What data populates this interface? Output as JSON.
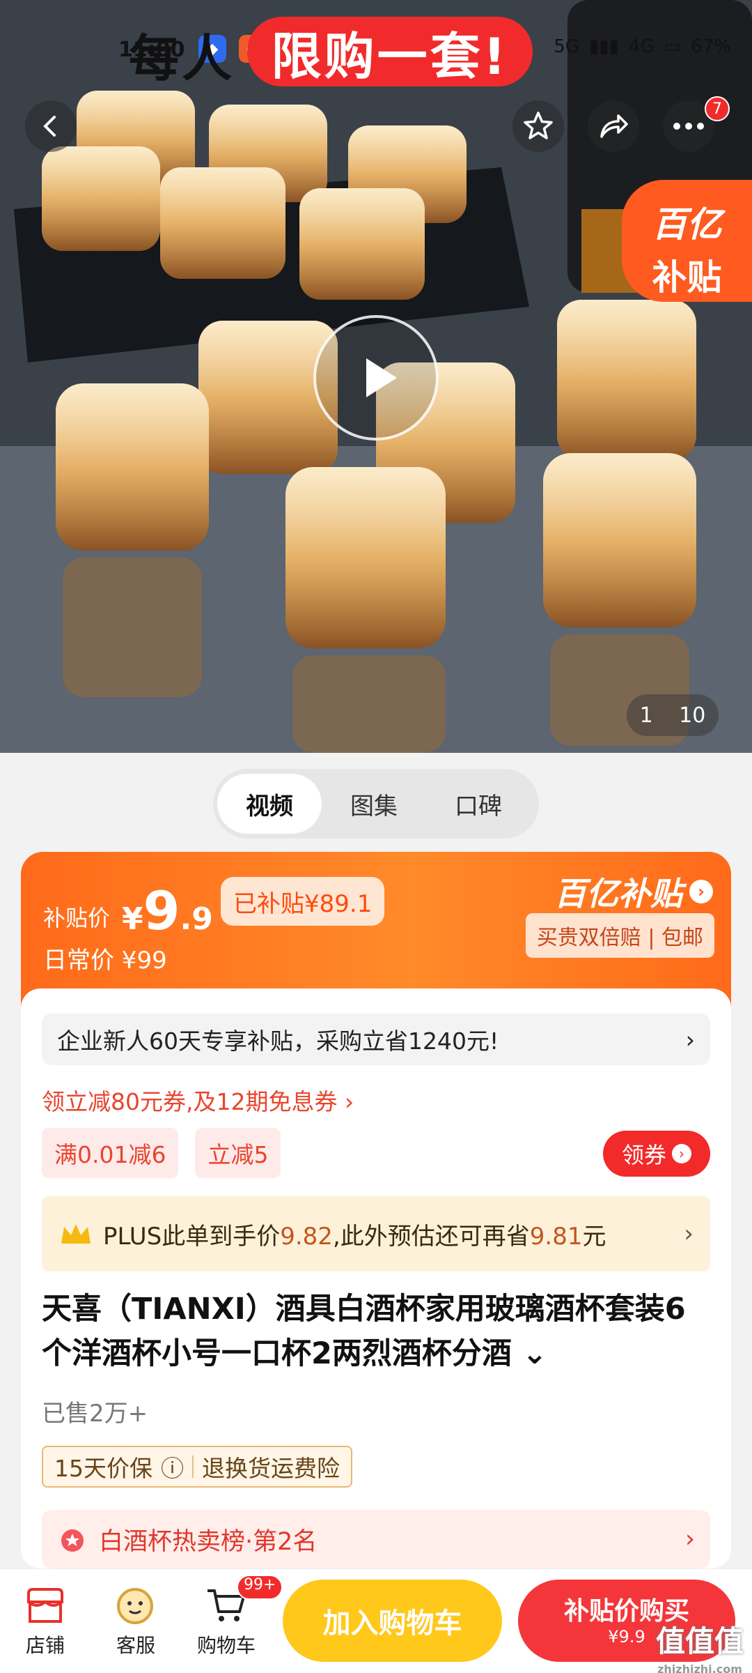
{
  "status_bar": {
    "time": "11:00",
    "network": "5G",
    "signal2": "4G",
    "battery": "67%"
  },
  "banner": {
    "prefix": "每人",
    "highlight": "限购一套!"
  },
  "nav": {
    "back_icon": "chevron-left-icon",
    "favorite_icon": "star-icon",
    "share_icon": "share-icon",
    "more_icon": "more-dots-icon",
    "more_badge": "7"
  },
  "subsidy_tag": {
    "line1": "百亿",
    "line2": "补贴"
  },
  "media": {
    "current": "1",
    "total": "10"
  },
  "media_tabs": [
    "视频",
    "图集",
    "口碑"
  ],
  "price": {
    "label": "补贴价",
    "currency": "¥",
    "integer": "9",
    "decimal": ".9",
    "subsidized": "已补贴¥89.1",
    "daily": "日常价 ¥99",
    "brand": "百亿补贴",
    "guarantee": "买贵双倍赔 | 包邮"
  },
  "promo": {
    "notice": "企业新人60天专享补贴，采购立省1240元!",
    "coupon_line": "领立减80元券,及12期免息券 ›",
    "chips": [
      "满0.01减6",
      "立减5"
    ],
    "get_coupon": "领券",
    "plus_prefix": "PLUS此单到手价",
    "plus_price": "9.82",
    "plus_mid": ",此外预估还可再省",
    "plus_save": "9.81",
    "plus_suffix": "元"
  },
  "product": {
    "title": "天喜（TIANXI）酒具白酒杯家用玻璃酒杯套装6个洋酒杯小号一口杯2两烈酒杯分酒",
    "sold": "已售2万+",
    "service1": "15天价保",
    "service2": "退换货运费险",
    "rank": "白酒杯热卖榜·第2名"
  },
  "bottom_bar": {
    "shop": "店铺",
    "service": "客服",
    "cart": "购物车",
    "cart_badge": "99+",
    "add_cart": "加入购物车",
    "buy_main": "补贴价购买",
    "buy_price": "¥9.9"
  },
  "watermark": {
    "text": "值值值",
    "url": "zhizhizhi.com"
  },
  "colors": {
    "accent_orange": "#ff6a1a",
    "accent_red": "#f4363a",
    "cart_yellow": "#ffc81a"
  }
}
